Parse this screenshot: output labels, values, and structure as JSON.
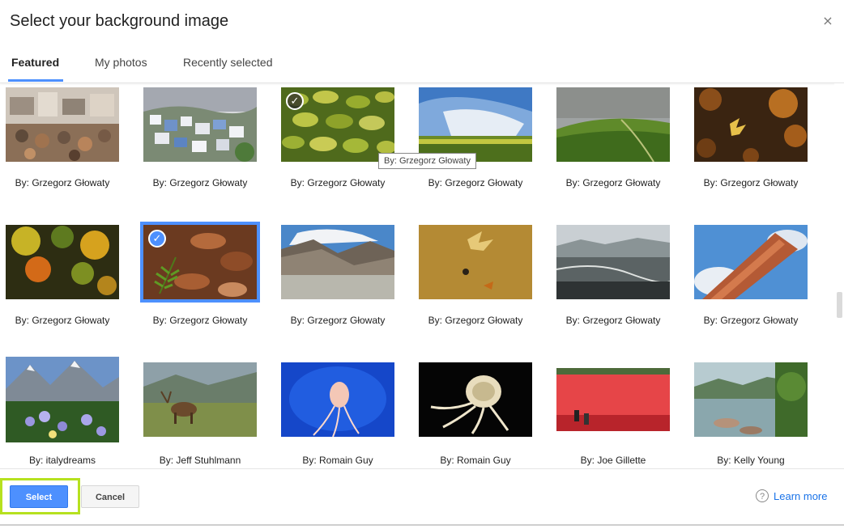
{
  "dialog": {
    "title": "Select your background image",
    "close_glyph": "×"
  },
  "tabs": [
    {
      "label": "Featured",
      "active": true
    },
    {
      "label": "My photos",
      "active": false
    },
    {
      "label": "Recently selected",
      "active": false
    }
  ],
  "images": [
    {
      "caption": "By: Grzegorz Głowaty",
      "scene": "tannery",
      "state": "normal"
    },
    {
      "caption": "By: Grzegorz Głowaty",
      "scene": "blue-town",
      "state": "normal"
    },
    {
      "caption": "By: Grzegorz Głowaty",
      "scene": "lily-pads",
      "state": "recent"
    },
    {
      "caption": "By: Grzegorz Głowaty",
      "scene": "field-sky",
      "state": "normal"
    },
    {
      "caption": "By: Grzegorz Głowaty",
      "scene": "green-hills",
      "state": "normal"
    },
    {
      "caption": "By: Grzegorz Głowaty",
      "scene": "autumn-leaf",
      "state": "normal"
    },
    {
      "caption": "By: Grzegorz Głowaty",
      "scene": "autumn-forest",
      "state": "normal"
    },
    {
      "caption": "By: Grzegorz Głowaty",
      "scene": "fern",
      "state": "selected"
    },
    {
      "caption": "By: Grzegorz Głowaty",
      "scene": "mountain-valley",
      "state": "normal"
    },
    {
      "caption": "By: Grzegorz Głowaty",
      "scene": "leaf-water",
      "state": "normal"
    },
    {
      "caption": "By: Grzegorz Głowaty",
      "scene": "aerial-valley",
      "state": "normal"
    },
    {
      "caption": "By: Grzegorz Głowaty",
      "scene": "brick-tower",
      "state": "normal"
    },
    {
      "caption": "By: italydreams",
      "scene": "wildflowers",
      "state": "normal"
    },
    {
      "caption": "By: Jeff Stuhlmann",
      "scene": "elk",
      "state": "normal"
    },
    {
      "caption": "By: Romain Guy",
      "scene": "jellyfish-blue",
      "state": "normal"
    },
    {
      "caption": "By: Romain Guy",
      "scene": "jellyfish-dark",
      "state": "normal"
    },
    {
      "caption": "By: Joe Gillette",
      "scene": "cranberry",
      "state": "normal"
    },
    {
      "caption": "By: Kelly Young",
      "scene": "lake",
      "state": "normal"
    }
  ],
  "tooltip": {
    "text": "By: Grzegorz Głowaty"
  },
  "footer": {
    "select_label": "Select",
    "cancel_label": "Cancel",
    "help_glyph": "?",
    "learn_more_label": "Learn more"
  },
  "colors": {
    "accent": "#4d90fe",
    "highlight": "#b6e11f",
    "link": "#1a73e8"
  }
}
